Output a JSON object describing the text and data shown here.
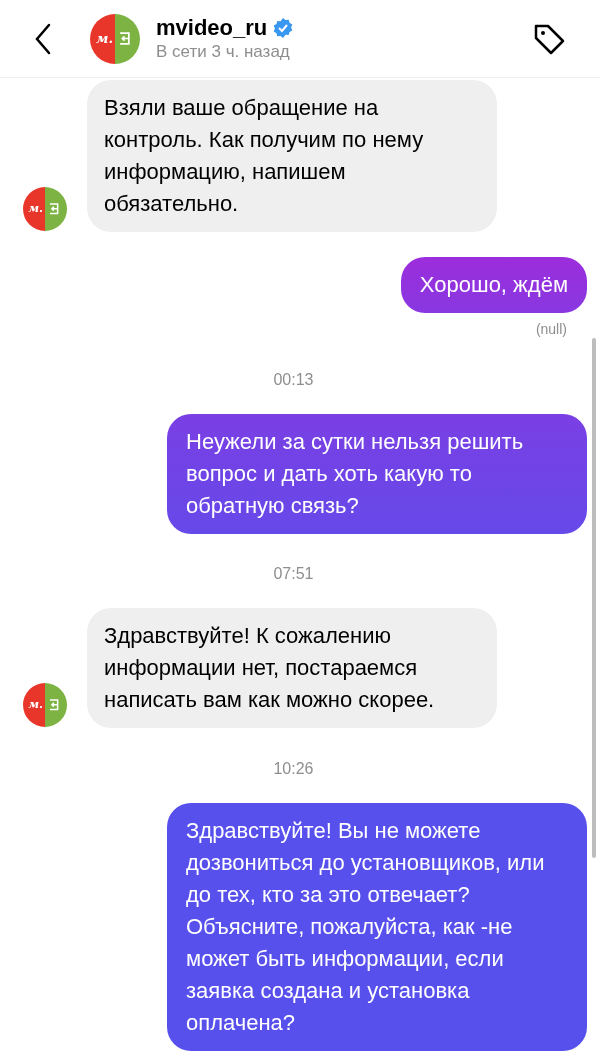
{
  "header": {
    "name": "mvideo_ru",
    "verified": true,
    "status": "В сети 3 ч. назад",
    "avatar_text": "м."
  },
  "messages": [
    {
      "kind": "incoming",
      "text": "Взяли ваше обращение на контроль. Как получим по нему информацию, напишем обязательно.",
      "avatar_text": "м."
    },
    {
      "kind": "outgoing",
      "text": "Хорошо, ждём"
    },
    {
      "kind": "status",
      "text": "(null)"
    },
    {
      "kind": "time",
      "text": "00:13"
    },
    {
      "kind": "outgoing",
      "text": "Неужели за сутки нельзя решить вопрос и дать хоть какую то обратную связь?"
    },
    {
      "kind": "time",
      "text": "07:51"
    },
    {
      "kind": "incoming",
      "text": "Здравствуйте! К сожалению информации нет, постараемся написать вам как можно скорее.",
      "avatar_text": "м."
    },
    {
      "kind": "time",
      "text": "10:26"
    },
    {
      "kind": "outgoing",
      "text": "Здравствуйте! Вы не можете дозвониться до установщиков, или до тех, кто за это отвечает? Объясните, пожалуйста, как -не может быть информации, если заявка создана и установка оплачена?"
    }
  ]
}
